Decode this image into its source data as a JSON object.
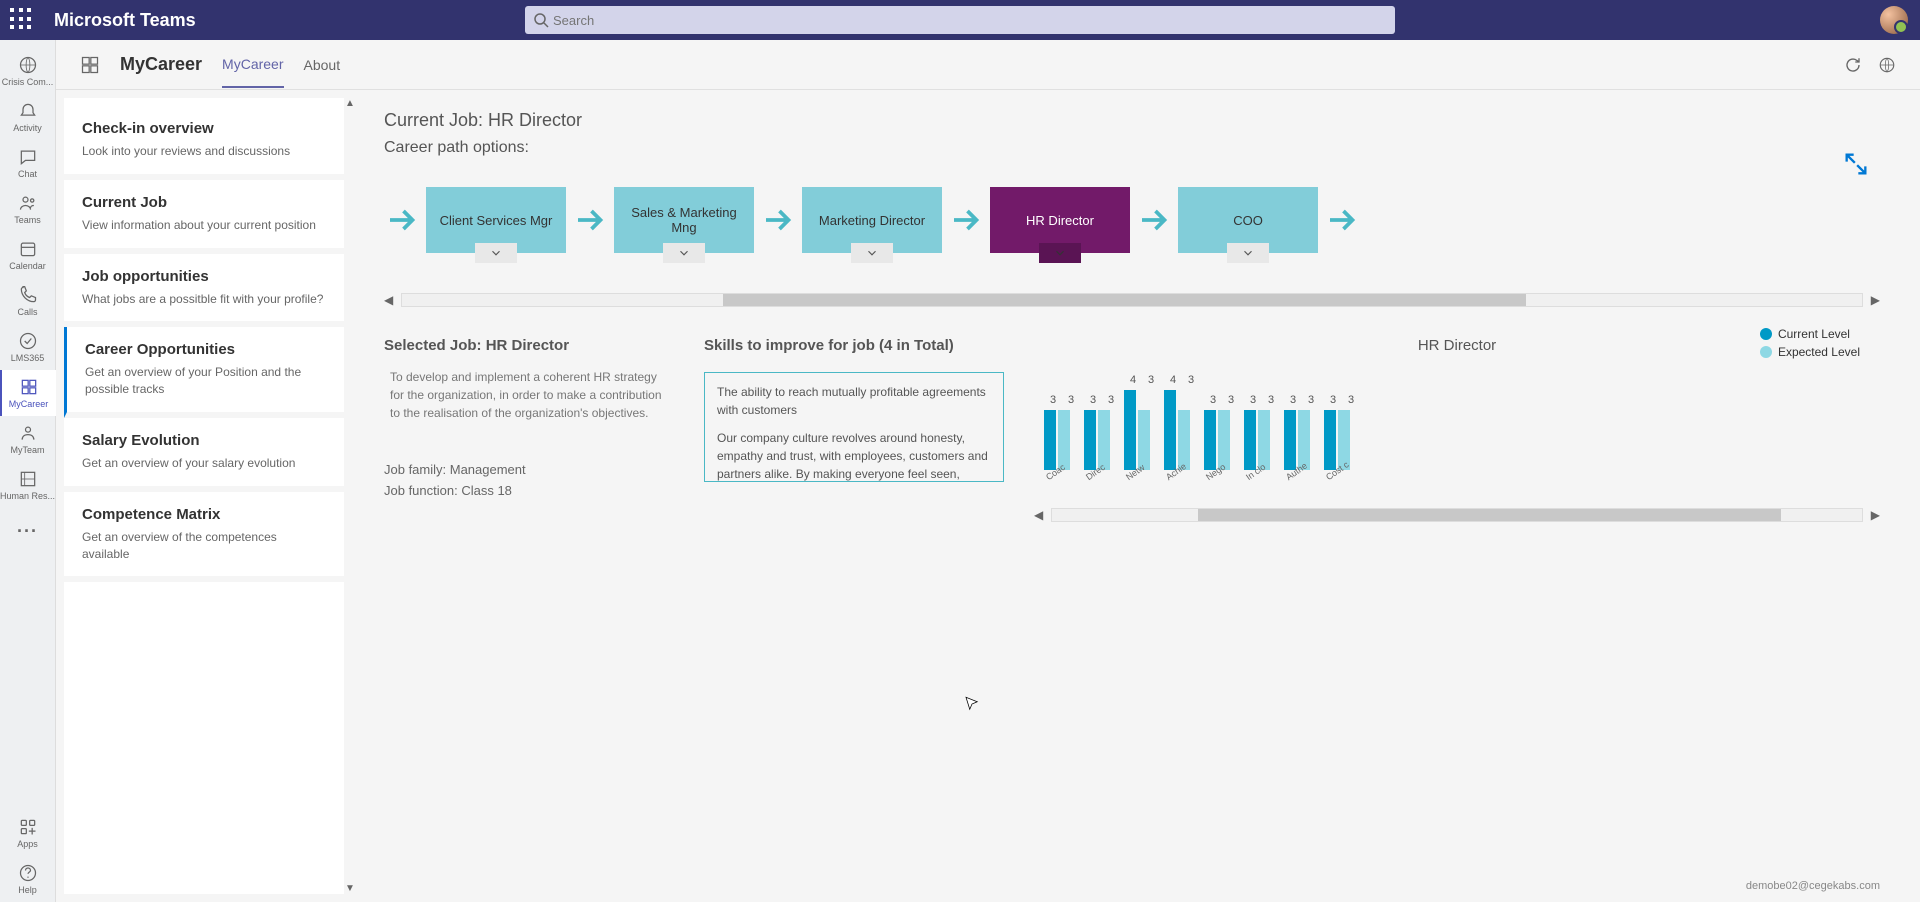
{
  "titlebar": {
    "appName": "Microsoft Teams",
    "searchPlaceholder": "Search"
  },
  "rail": [
    {
      "label": "Crisis Com..."
    },
    {
      "label": "Activity"
    },
    {
      "label": "Chat"
    },
    {
      "label": "Teams"
    },
    {
      "label": "Calendar"
    },
    {
      "label": "Calls"
    },
    {
      "label": "LMS365"
    },
    {
      "label": "MyCareer"
    },
    {
      "label": "MyTeam"
    },
    {
      "label": "Human Res..."
    }
  ],
  "railBottom": {
    "apps": "Apps",
    "help": "Help"
  },
  "header": {
    "pageName": "MyCareer",
    "tabs": [
      "MyCareer",
      "About"
    ],
    "activeTab": 0
  },
  "side": [
    {
      "title": "Check-in overview",
      "desc": "Look into your reviews and discussions"
    },
    {
      "title": "Current Job",
      "desc": "View information about your current position"
    },
    {
      "title": "Job opportunities",
      "desc": "What jobs are a possitble fit with your profile?"
    },
    {
      "title": "Career Opportunities",
      "desc": "Get an overview of your Position and the possible tracks"
    },
    {
      "title": "Salary Evolution",
      "desc": "Get an overview of your salary evolution"
    },
    {
      "title": "Competence Matrix",
      "desc": "Get an overview of the competences available"
    }
  ],
  "sideActive": 3,
  "detail": {
    "currentJob": "Current Job: HR Director",
    "pathLabel": "Career path options:",
    "path": [
      "Client Services Mgr",
      "Sales & Marketing Mng",
      "Marketing Director",
      "HR Director",
      "COO"
    ],
    "pathSelected": 3,
    "selectedJobTitle": "Selected Job: HR Director",
    "selectedJobDesc": "To develop and implement a coherent HR strategy for the organization, in order to make a contribution to the realisation of the organization's objectives.",
    "jobFamily": "Job family: Management",
    "jobFunction": "Job function: Class 18",
    "skillsTitle": "Skills to improve for job (4 in Total)",
    "skillP1": "The ability to reach mutually profitable agreements with customers",
    "skillP2": "Our company culture revolves around honesty, empathy and trust, with employees, customers and partners alike. By making everyone feel seen, heard and valued, we create an atmosphere of connection and togetherness."
  },
  "chart": {
    "title": "HR Director",
    "legend": {
      "current": "Current Level",
      "expected": "Expected Level"
    },
    "email": "demobe02@cegekabs.com"
  },
  "chart_data": {
    "type": "bar",
    "title": "HR Director",
    "categories": [
      "Coac",
      "Direc",
      "Netw",
      "Achie",
      "Nego",
      "In clo",
      "Authe",
      "Cost c"
    ],
    "series": [
      {
        "name": "Current Level",
        "values": [
          3,
          3,
          4,
          4,
          3,
          3,
          3,
          3
        ]
      },
      {
        "name": "Expected Level",
        "values": [
          3,
          3,
          3,
          3,
          3,
          3,
          3,
          3
        ]
      }
    ],
    "ylim": [
      0,
      4
    ]
  }
}
